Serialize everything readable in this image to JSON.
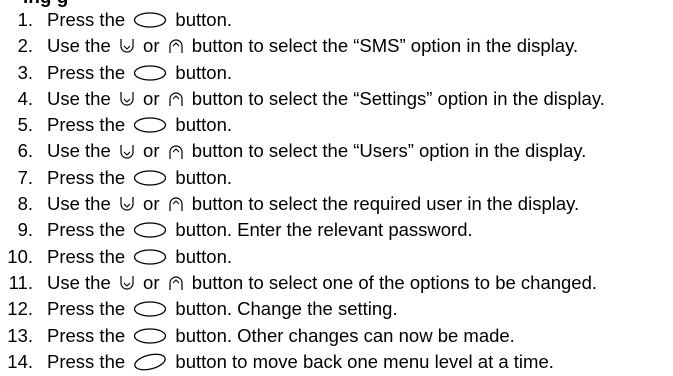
{
  "heading_fragment": "ing g",
  "steps": [
    {
      "num": "1.",
      "parts": [
        {
          "t": "Press the "
        },
        {
          "icon": "oval-ok-button-icon"
        },
        {
          "t": " button."
        }
      ]
    },
    {
      "num": "2.",
      "parts": [
        {
          "t": "Use the "
        },
        {
          "icon": "down-arrow-button-icon"
        },
        {
          "t": " or "
        },
        {
          "icon": "up-arrow-button-icon"
        },
        {
          "t": " button to select the “SMS” option in the display."
        }
      ]
    },
    {
      "num": "3.",
      "parts": [
        {
          "t": "Press the "
        },
        {
          "icon": "oval-ok-button-icon"
        },
        {
          "t": " button."
        }
      ]
    },
    {
      "num": "4.",
      "parts": [
        {
          "t": "Use the "
        },
        {
          "icon": "down-arrow-button-icon"
        },
        {
          "t": " or "
        },
        {
          "icon": "up-arrow-button-icon"
        },
        {
          "t": " button to select the “Settings” option in the display."
        }
      ]
    },
    {
      "num": "5.",
      "parts": [
        {
          "t": "Press the "
        },
        {
          "icon": "oval-ok-button-icon"
        },
        {
          "t": " button."
        }
      ]
    },
    {
      "num": "6.",
      "parts": [
        {
          "t": "Use the "
        },
        {
          "icon": "down-arrow-button-icon"
        },
        {
          "t": " or "
        },
        {
          "icon": "up-arrow-button-icon"
        },
        {
          "t": " button to select the “Users” option in the display."
        }
      ]
    },
    {
      "num": "7.",
      "parts": [
        {
          "t": "Press the "
        },
        {
          "icon": "oval-ok-button-icon"
        },
        {
          "t": " button."
        }
      ]
    },
    {
      "num": "8.",
      "parts": [
        {
          "t": "Use the "
        },
        {
          "icon": "down-arrow-button-icon"
        },
        {
          "t": " or "
        },
        {
          "icon": "up-arrow-button-icon"
        },
        {
          "t": " button to select the required user in the display."
        }
      ]
    },
    {
      "num": "9.",
      "parts": [
        {
          "t": "Press the "
        },
        {
          "icon": "oval-ok-button-icon"
        },
        {
          "t": " button. Enter the relevant password."
        }
      ]
    },
    {
      "num": "10.",
      "parts": [
        {
          "t": "Press the "
        },
        {
          "icon": "oval-ok-button-icon"
        },
        {
          "t": " button."
        }
      ]
    },
    {
      "num": "11.",
      "parts": [
        {
          "t": "Use the "
        },
        {
          "icon": "down-arrow-button-icon"
        },
        {
          "t": " or "
        },
        {
          "icon": "up-arrow-button-icon"
        },
        {
          "t": " button to select one of the options to be changed."
        }
      ]
    },
    {
      "num": "12.",
      "parts": [
        {
          "t": "Press the "
        },
        {
          "icon": "oval-ok-button-icon"
        },
        {
          "t": " button. Change the setting."
        }
      ]
    },
    {
      "num": "13.",
      "parts": [
        {
          "t": "Press the "
        },
        {
          "icon": "oval-ok-button-icon"
        },
        {
          "t": " button. Other changes can now be made."
        }
      ]
    },
    {
      "num": "14.",
      "parts": [
        {
          "t": "Press the "
        },
        {
          "icon": "oval-back-button-icon"
        },
        {
          "t": " button to move back one menu level at a time."
        }
      ]
    }
  ]
}
